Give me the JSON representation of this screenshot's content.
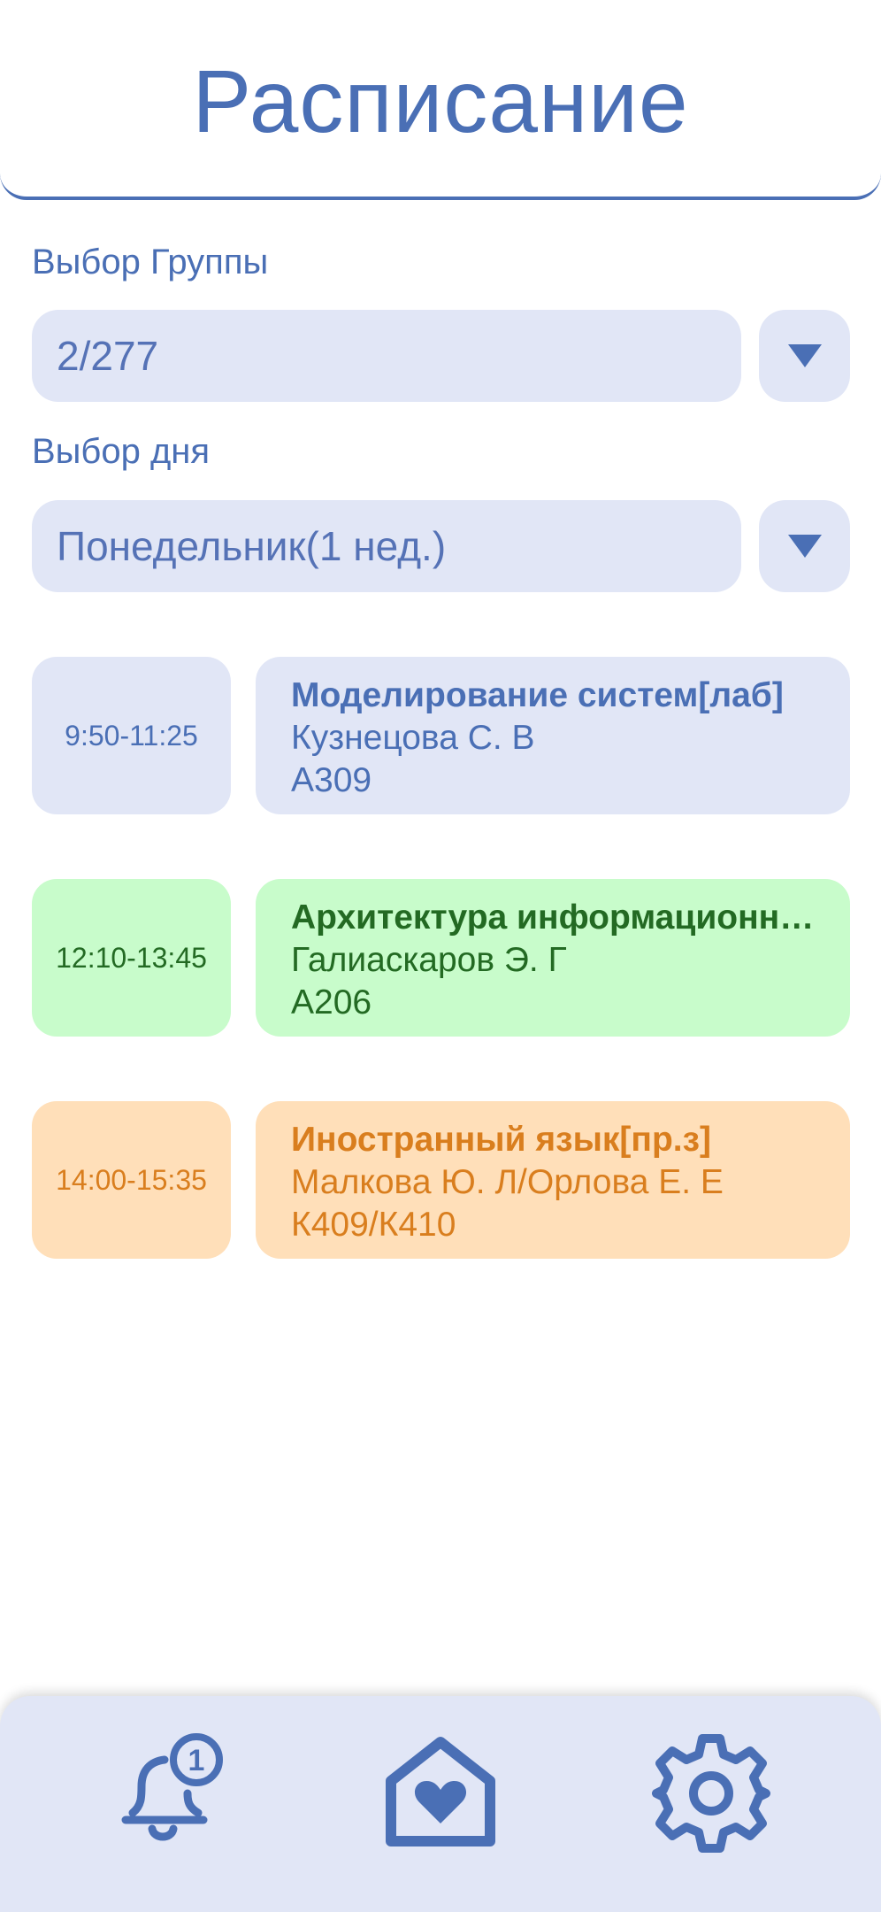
{
  "header": {
    "title": "Расписание"
  },
  "group": {
    "label": "Выбор Группы",
    "value": "2/277"
  },
  "day": {
    "label": "Выбор дня",
    "value": "Понедельник(1 нед.)"
  },
  "lessons": [
    {
      "time": "9:50-11:25",
      "title": "Моделирование систем[лаб]",
      "teacher": "Кузнецова С. В",
      "room": "А309",
      "color": "blue"
    },
    {
      "time": "12:10-13:45",
      "title": "Архитектура информационных систем",
      "teacher": "Галиаскаров Э. Г",
      "room": "А206",
      "color": "green"
    },
    {
      "time": "14:00-15:35",
      "title": "Иностранный язык[пр.з]",
      "teacher": "Малкова Ю. Л/Орлова Е. Е",
      "room": "К409/К410",
      "color": "orange"
    }
  ],
  "nav": {
    "notification_icon": "bell-icon",
    "notification_badge": "1",
    "home_icon": "home-heart-icon",
    "settings_icon": "gear-icon"
  },
  "colors": {
    "accent": "#4a6fb5",
    "panel": "#e1e6f6",
    "green_bg": "#c8fccb",
    "green_text": "#236a23",
    "orange_bg": "#ffdfb9",
    "orange_text": "#d97e1e"
  }
}
